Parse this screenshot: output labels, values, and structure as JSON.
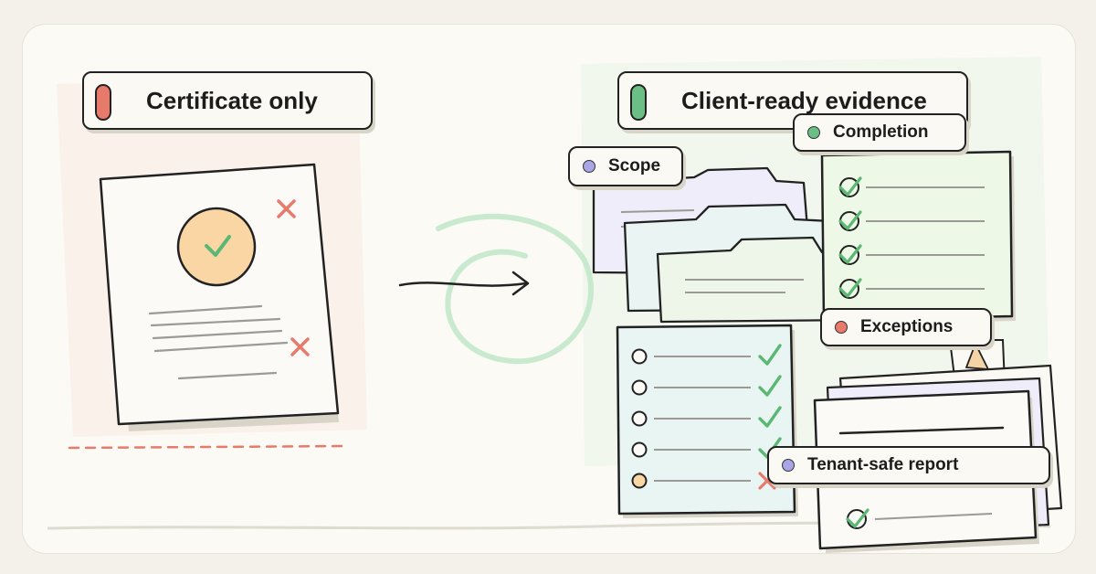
{
  "comparison": {
    "left": {
      "title": "Certificate only",
      "pill_color": "#e77b6b"
    },
    "right": {
      "title": "Client-ready evidence",
      "pill_color": "#6cbf84"
    }
  },
  "evidence_tags": [
    {
      "id": "scope",
      "label": "Scope",
      "dot_color": "#a9a5e6"
    },
    {
      "id": "completion",
      "label": "Completion",
      "dot_color": "#6cbf84"
    },
    {
      "id": "exceptions",
      "label": "Exceptions",
      "dot_color": "#e77b6b"
    },
    {
      "id": "tenant",
      "label": "Tenant-safe report",
      "dot_color": "#a9a5e6"
    }
  ],
  "colors": {
    "check": "#5bb874",
    "cross": "#e77b6b",
    "seal": "#f9d6a4",
    "swirl": "#bfe6c8"
  }
}
